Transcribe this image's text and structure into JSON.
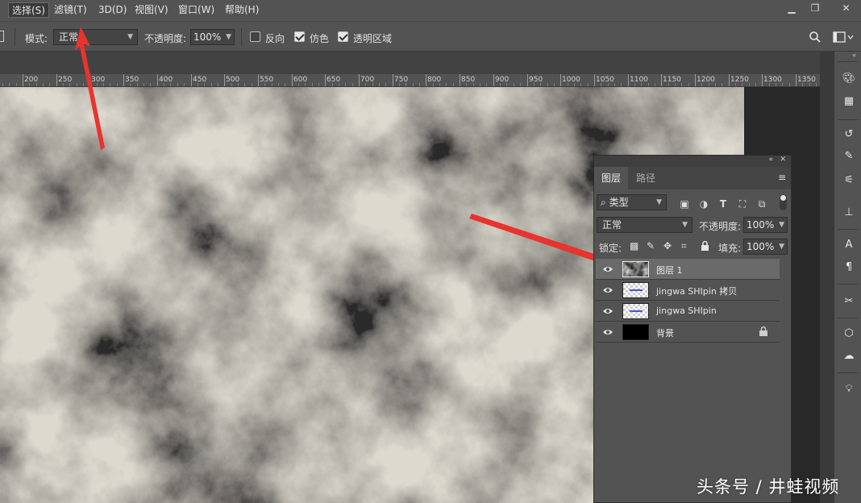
{
  "menubar": {
    "items": [
      {
        "label": "选择(S)",
        "active": true
      },
      {
        "label": "滤镜(T)",
        "active": false
      },
      {
        "label": "3D(D)",
        "active": false
      },
      {
        "label": "视图(V)",
        "active": false
      },
      {
        "label": "窗口(W)",
        "active": false
      },
      {
        "label": "帮助(H)",
        "active": false
      }
    ],
    "window_controls": {
      "minimize": "▁",
      "restore": "❐",
      "close": "✕"
    }
  },
  "options": {
    "mode_label": "模式:",
    "mode_value": "正常",
    "opacity_label": "不透明度:",
    "opacity_value": "100%",
    "reverse_label": "反向",
    "reverse_checked": false,
    "dither_label": "仿色",
    "dither_checked": true,
    "transparency_label": "透明区域",
    "transparency_checked": true
  },
  "ruler": {
    "labels": [
      "200",
      "250",
      "300",
      "350",
      "400",
      "450",
      "500",
      "550",
      "600",
      "650",
      "700",
      "750",
      "800",
      "850",
      "900",
      "950",
      "1000",
      "1050",
      "1100",
      "1150",
      "1200",
      "1250",
      "1300",
      "1350"
    ]
  },
  "layers_panel": {
    "tabs": [
      {
        "label": "图层",
        "active": true
      },
      {
        "label": "路径",
        "active": false
      }
    ],
    "filter_kind": "类型",
    "blend_mode": "正常",
    "opacity_label": "不透明度:",
    "opacity_value": "100%",
    "lock_label": "锁定:",
    "fill_label": "填充:",
    "fill_value": "100%",
    "layers": [
      {
        "name": "图层 1",
        "visible": true,
        "selected": true,
        "thumb": "clouds",
        "locked": false
      },
      {
        "name": "jingwa SHIpin 拷贝",
        "visible": true,
        "selected": false,
        "thumb": "text-transparent",
        "locked": false
      },
      {
        "name": "jingwa SHIpin",
        "visible": true,
        "selected": false,
        "thumb": "text-transparent",
        "locked": false
      },
      {
        "name": "背景",
        "visible": true,
        "selected": false,
        "thumb": "black",
        "locked": true
      }
    ]
  },
  "watermark": "头条号 / 井蛙视频",
  "colors": {
    "ui_dark": "#535353",
    "canvas_bg": "#282828",
    "annotation_arrow": "#e8332f"
  }
}
